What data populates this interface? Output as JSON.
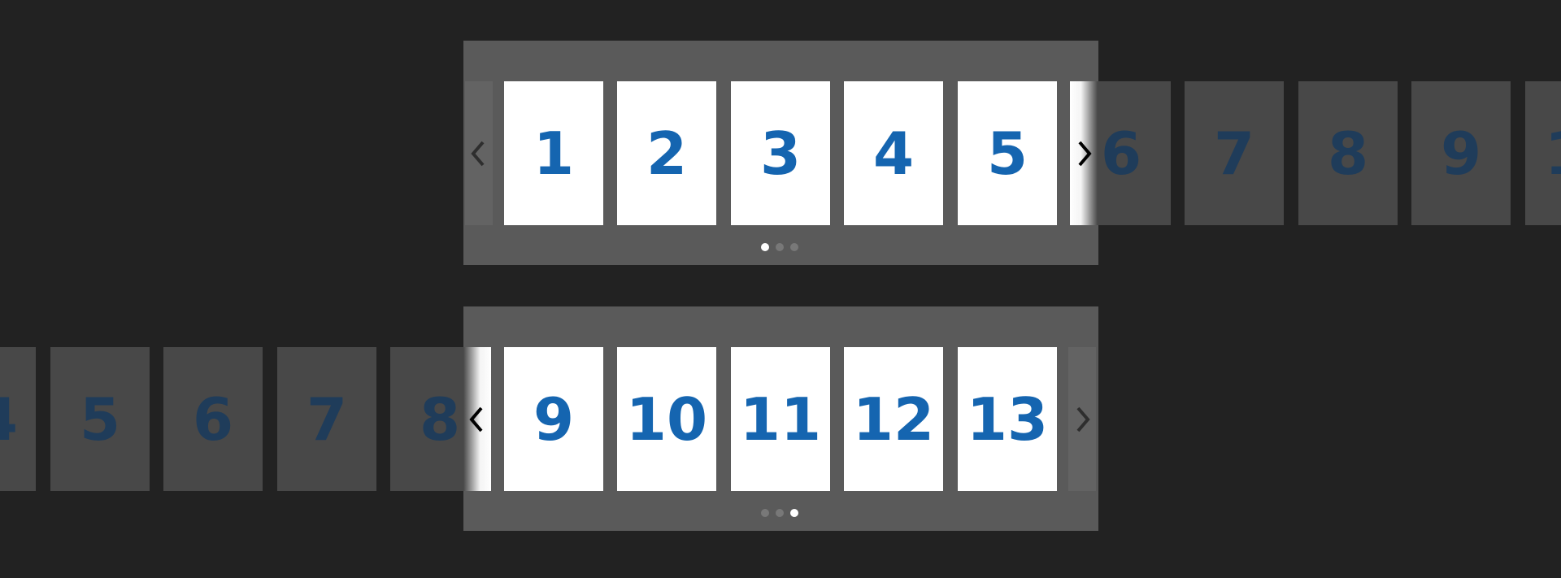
{
  "carousel_top": {
    "active_page": 1,
    "page_count": 3,
    "slides_visible": [
      "1",
      "2",
      "3",
      "4",
      "5"
    ],
    "slides_overflow": [
      "6",
      "7",
      "8",
      "9",
      "1"
    ],
    "prev_icon": "chevron-left-icon",
    "next_icon": "chevron-right-icon"
  },
  "carousel_bottom": {
    "active_page": 3,
    "page_count": 3,
    "slides_overflow": [
      "4",
      "5",
      "6",
      "7",
      "8"
    ],
    "slides_visible": [
      "9",
      "10",
      "11",
      "12",
      "13"
    ],
    "prev_icon": "chevron-left-icon",
    "next_icon": "chevron-right-icon"
  },
  "colors": {
    "background": "#222222",
    "frame": "#5a5a5a",
    "card": "#ffffff",
    "card_text": "#1565b0",
    "ghost_card": "#484848",
    "ghost_text": "#1f3c5a",
    "dot_active": "#ffffff",
    "dot_inactive": "#787878"
  }
}
